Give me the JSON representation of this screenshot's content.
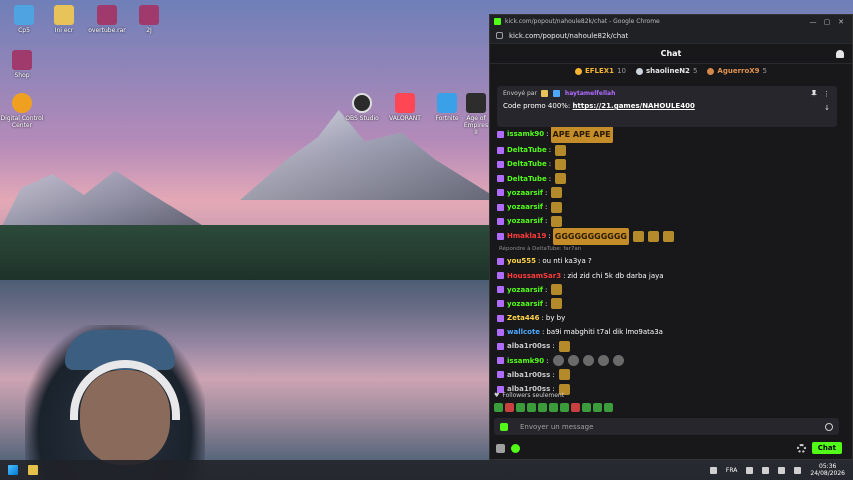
{
  "desktop": {
    "icons": [
      {
        "label": "Cp5",
        "icon": "monitor-icon",
        "color": "#4fa3e0"
      },
      {
        "label": "Ini ecr",
        "icon": "folder-icon",
        "color": "#e8c35a"
      },
      {
        "label": "overtube.rar",
        "icon": "winrar-icon",
        "color": "#a03a6c"
      },
      {
        "label": "2J",
        "icon": "winrar-icon",
        "color": "#a03a6c"
      },
      {
        "label": "Shop",
        "icon": "winrar-icon",
        "color": "#a03a6c"
      },
      {
        "label": "Digital Control Center",
        "icon": "sun-icon",
        "color": "#f0a020"
      },
      {
        "label": "OBS Studio",
        "icon": "obs-icon",
        "color": "#2b2b2b"
      },
      {
        "label": "VALORANT",
        "icon": "valorant-icon",
        "color": "#ff4655"
      },
      {
        "label": "Fortnite",
        "icon": "fortnite-icon",
        "color": "#3aa0e8"
      },
      {
        "label": "Age of Empires II",
        "icon": "game-icon",
        "color": "#2d2d2d"
      }
    ]
  },
  "window": {
    "title": "kick.com/popout/nahoule82k/chat - Google Chrome",
    "url": "kick.com/popout/nahoule82k/chat",
    "controls": [
      "—",
      "▢",
      "✕"
    ]
  },
  "chat": {
    "header": "Chat",
    "leaders": [
      {
        "name": "EFLEX1",
        "count": "10",
        "color": "#f5b531"
      },
      {
        "name": "shaolineN2",
        "count": "5",
        "color": "#cfd4dc"
      },
      {
        "name": "AguerroX9",
        "count": "5",
        "color": "#d4894a"
      }
    ],
    "pinned": {
      "prefix": "Envoyé par",
      "sender": "haytamelfellah",
      "text": "Code promo 400%:",
      "link": "https://21.games/NAHOULE400"
    },
    "messages": [
      {
        "user": "DeltaTube",
        "color": "#53fc18",
        "text": "",
        "emotes": 1
      },
      {
        "user": "issamk90",
        "color": "#53fc18",
        "big": "APE APE APE",
        "text": ""
      },
      {
        "user": "DeltaTube",
        "color": "#53fc18",
        "text": "",
        "emotes": 1
      },
      {
        "user": "DeltaTube",
        "color": "#53fc18",
        "text": "",
        "emotes": 1
      },
      {
        "user": "DeltaTube",
        "color": "#53fc18",
        "text": "",
        "emotes": 1
      },
      {
        "user": "yozaarsif",
        "color": "#53fc18",
        "text": "",
        "emotes": 1
      },
      {
        "user": "yozaarsif",
        "color": "#53fc18",
        "text": "",
        "emotes": 1
      },
      {
        "user": "yozaarsif",
        "color": "#53fc18",
        "text": "",
        "emotes": 1
      },
      {
        "user": "Hmakla19",
        "color": "#ff3b3b",
        "big": "GGGGGGGGGGG",
        "emotes": 3
      },
      {
        "reply": "Répondre à DeltaTube: far7an"
      },
      {
        "user": "you555",
        "color": "#ffd447",
        "text": "ou nti ka3ya ?"
      },
      {
        "user": "HoussamSar3",
        "color": "#ff3b3b",
        "text": "zid zid chi 5k db darba jaya"
      },
      {
        "user": "yozaarsif",
        "color": "#53fc18",
        "text": "",
        "emotes": 1
      },
      {
        "user": "yozaarsif",
        "color": "#53fc18",
        "text": "",
        "emotes": 1
      },
      {
        "user": "Zeta446",
        "color": "#ffd447",
        "text": "by by"
      },
      {
        "user": "wallcote",
        "color": "#4ea8ff",
        "text": "ba9i mabghiti t7al dik lmo9ata3a"
      },
      {
        "user": "alba1r00ss",
        "color": "#c9c9c9",
        "text": "",
        "emotes": 1
      },
      {
        "user": "issamk90",
        "color": "#53fc18",
        "text": "",
        "emotes": 5,
        "grey": true
      },
      {
        "user": "alba1r00ss",
        "color": "#c9c9c9",
        "text": "",
        "emotes": 1
      },
      {
        "user": "alba1r00ss",
        "color": "#c9c9c9",
        "text": "",
        "emotes": 1
      }
    ],
    "followers_label": "Followers seulement",
    "input_placeholder": "Envoyer un message",
    "send_label": "Chat",
    "brand_color": "#53fc18"
  },
  "taskbar": {
    "lang": "FRA",
    "time": "05:36",
    "date": "24/08/2026"
  }
}
